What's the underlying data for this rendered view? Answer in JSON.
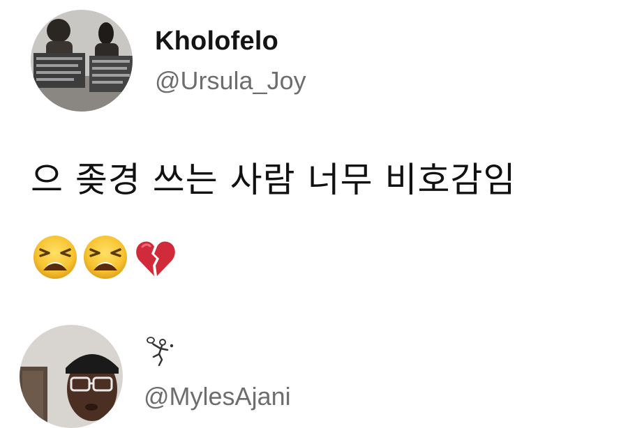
{
  "tweet1": {
    "display_name": "Kholofelo",
    "handle": "@Ursula_Joy",
    "text": "으 좆경 쓰는 사람 너무 비호감임",
    "emojis": [
      "tired-face",
      "tired-face",
      "broken-heart"
    ]
  },
  "tweet2": {
    "display_name_icon": "badminton-player-icon",
    "handle": "@MylesAjani"
  }
}
